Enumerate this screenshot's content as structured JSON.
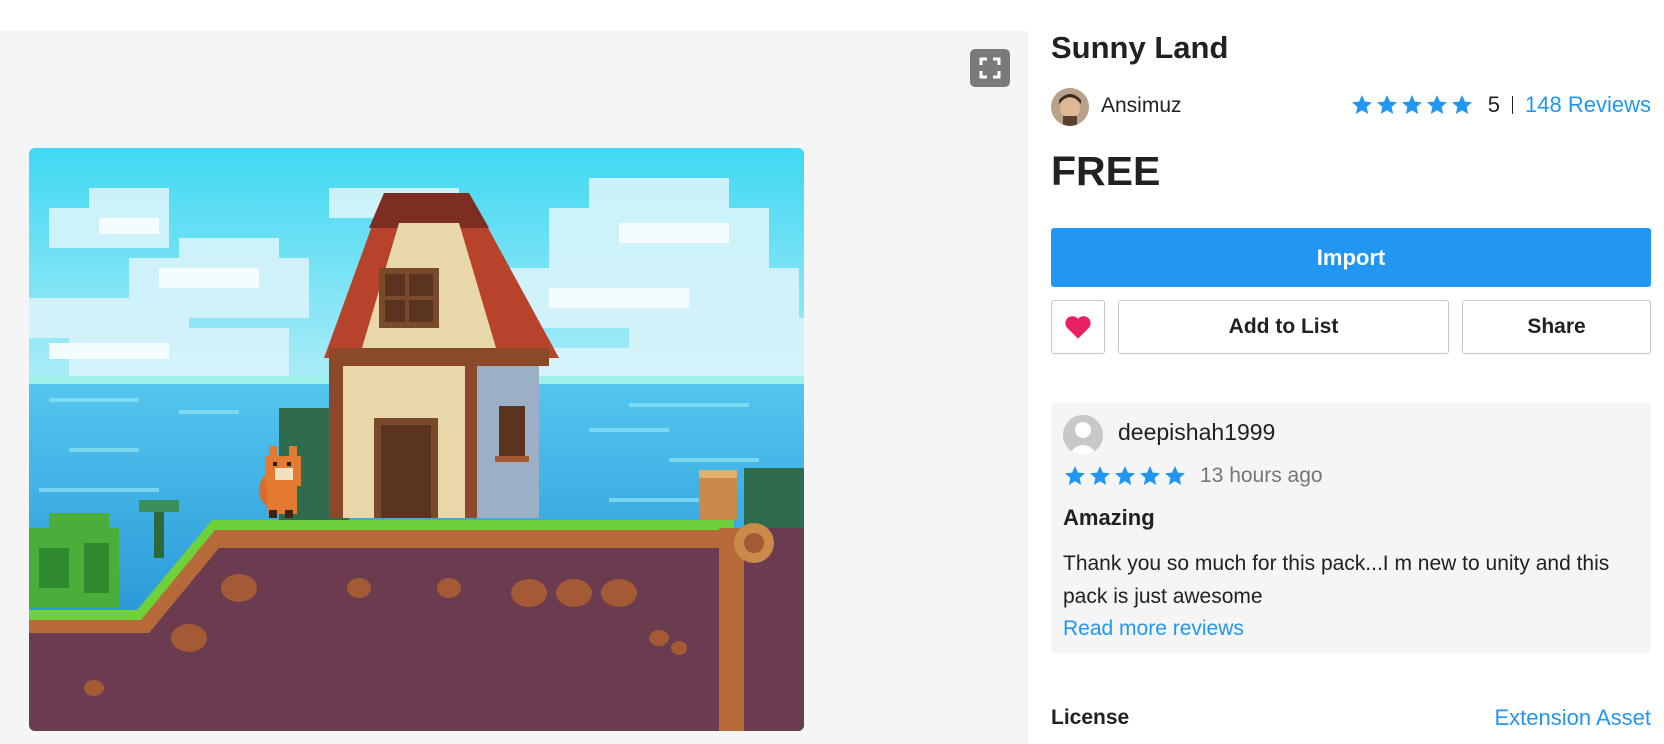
{
  "product": {
    "title": "Sunny Land",
    "author": "Ansimuz",
    "rating_value": "5",
    "rating_stars": 5,
    "reviews_link": "148 Reviews",
    "price": "FREE"
  },
  "actions": {
    "import_label": "Import",
    "add_to_list_label": "Add to List",
    "share_label": "Share",
    "favorite_icon": "heart-icon"
  },
  "review": {
    "reviewer": "deepishah1999",
    "stars": 5,
    "time": "13 hours ago",
    "title": "Amazing",
    "body": "Thank you so much for this pack...I m new to unity and this pack is just awesome",
    "read_more": "Read more reviews"
  },
  "license": {
    "label": "License",
    "value": "Extension Asset"
  },
  "gallery": {
    "fullscreen_icon": "fullscreen-icon",
    "preview_image": "pixel-art-house-scene"
  },
  "colors": {
    "accent": "#2196f3",
    "heart": "#e91e63",
    "star": "#2196f3"
  }
}
